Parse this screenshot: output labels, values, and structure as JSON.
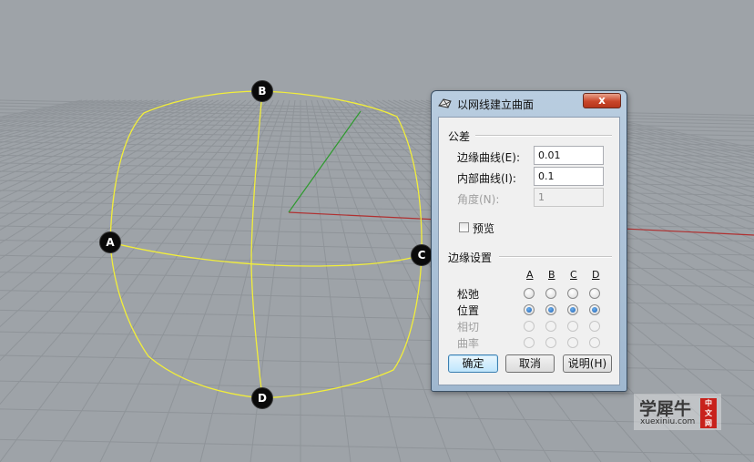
{
  "viewport": {
    "markers": [
      "A",
      "B",
      "C",
      "D"
    ],
    "colors": {
      "background": "#9ea3a8",
      "grid": "#8f9499",
      "curve": "#f2ee3a",
      "x_axis": "#b03030",
      "y_axis": "#2f9a2f"
    }
  },
  "dialog": {
    "title": "以网线建立曲面",
    "close_glyph": "x",
    "icon": "surface-from-network-icon",
    "tolerance": {
      "label": "公差",
      "edge_curves_label": "边缘曲线(E):",
      "edge_curves_value": "0.01",
      "interior_curves_label": "内部曲线(I):",
      "interior_curves_value": "0.1",
      "angle_label": "角度(N):",
      "angle_value": "1"
    },
    "preview_label": "预览",
    "preview_checked": false,
    "edge_settings": {
      "label": "边缘设置",
      "columns": [
        "A",
        "B",
        "C",
        "D"
      ],
      "rows": [
        {
          "label": "松弛",
          "enabled": true,
          "selected": [
            false,
            false,
            false,
            false
          ]
        },
        {
          "label": "位置",
          "enabled": true,
          "selected": [
            true,
            true,
            true,
            true
          ]
        },
        {
          "label": "相切",
          "enabled": false,
          "selected": [
            false,
            false,
            false,
            false
          ]
        },
        {
          "label": "曲率",
          "enabled": false,
          "selected": [
            false,
            false,
            false,
            false
          ]
        }
      ]
    },
    "buttons": {
      "ok": "确定",
      "cancel": "取消",
      "help": "说明(H)"
    }
  },
  "watermark": {
    "big": "学犀牛",
    "small": "xuexiniu.com",
    "badge": [
      "中",
      "文",
      "网"
    ]
  }
}
